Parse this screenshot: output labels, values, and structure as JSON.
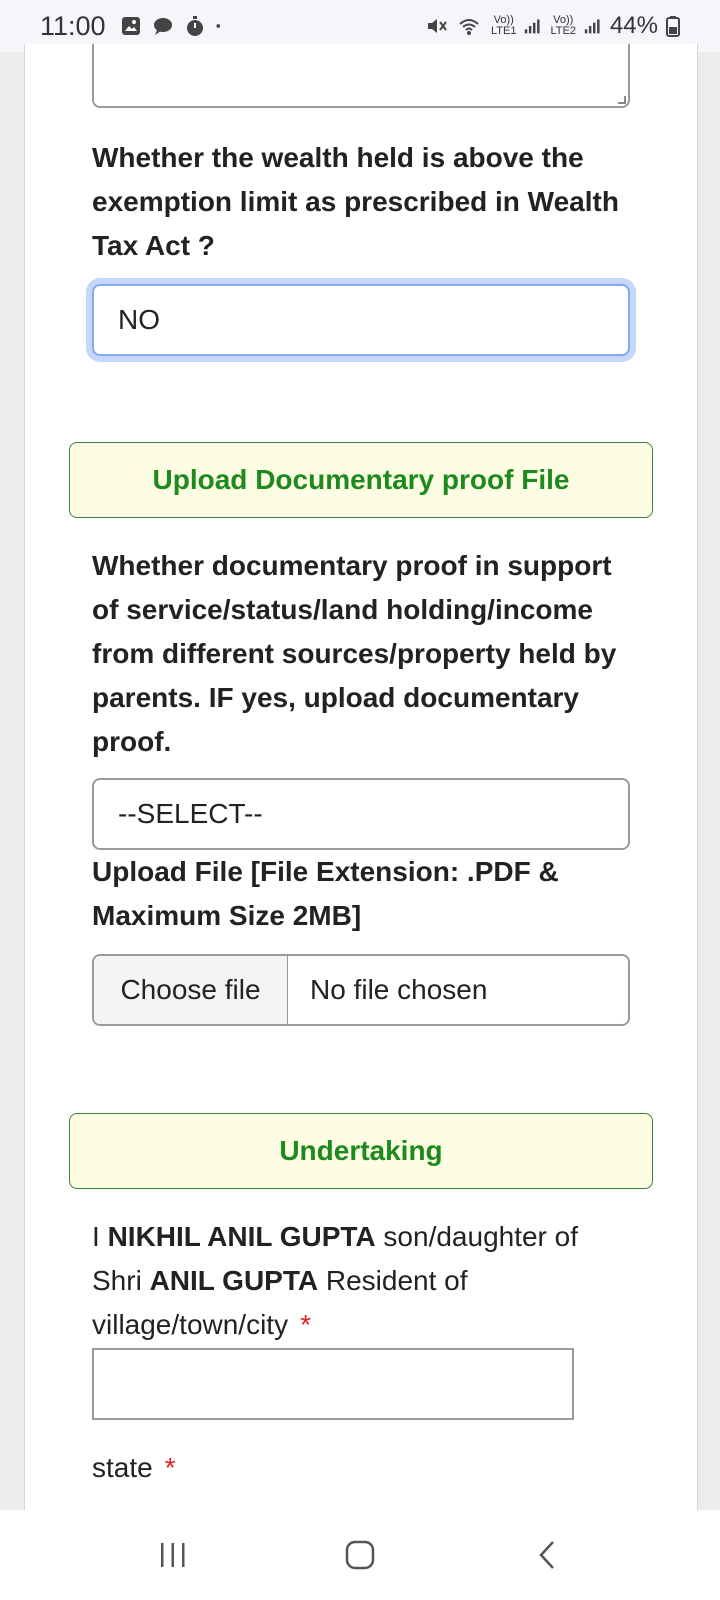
{
  "status_bar": {
    "time": "11:00",
    "sig1_label_top": "Vo))",
    "sig1_label_bottom": "LTE1",
    "sig2_label_top": "Vo))",
    "sig2_label_bottom": "LTE2",
    "battery": "44%"
  },
  "form": {
    "wealth_question": "Whether the wealth held is above the exemption limit as prescribed in Wealth Tax Act ?",
    "wealth_value": "NO",
    "upload_section_title": "Upload Documentary proof File",
    "proof_question": "Whether documentary proof in support of service/status/land holding/income from different sources/property held by parents. IF yes, upload documentary proof.",
    "proof_select": "--SELECT--",
    "upload_label": "Upload File [File Extension: .PDF & Maximum Size 2MB]",
    "file_button": "Choose file",
    "file_status": "No file chosen",
    "undertaking_title": "Undertaking",
    "undertaking": {
      "prefix": "I",
      "name": "NIKHIL ANIL GUPTA",
      "mid": "son/daughter of Shri",
      "father": "ANIL GUPTA",
      "suffix": "Resident of village/town/city",
      "required_mark": "*"
    },
    "city_value": "",
    "state_label": "state",
    "state_required": "*"
  }
}
